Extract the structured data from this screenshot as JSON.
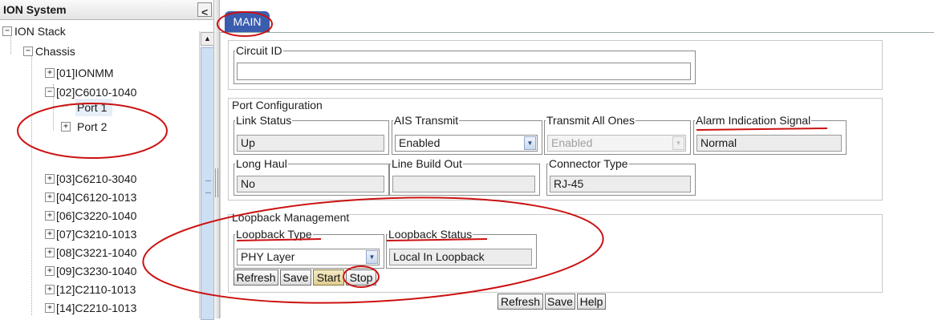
{
  "left_panel": {
    "title": "ION System",
    "collapse_glyph": "<",
    "tree": [
      {
        "label": "ION Stack",
        "level": 0,
        "expander": "−"
      },
      {
        "label": "Chassis",
        "level": 1,
        "expander": "−"
      },
      {
        "label": "[01]IONMM",
        "level": 2,
        "expander": "+"
      },
      {
        "label": "[02]C6010-1040",
        "level": 2,
        "expander": "−"
      },
      {
        "label": "Port 1",
        "level": 3,
        "expander": ""
      },
      {
        "label": "Port 2",
        "level": 3,
        "expander": "+"
      },
      {
        "label": "[03]C6210-3040",
        "level": 2,
        "expander": "+"
      },
      {
        "label": "[04]C6120-1013",
        "level": 2,
        "expander": "+"
      },
      {
        "label": "[06]C3220-1040",
        "level": 2,
        "expander": "+"
      },
      {
        "label": "[07]C3210-1013",
        "level": 2,
        "expander": "+"
      },
      {
        "label": "[08]C3221-1040",
        "level": 2,
        "expander": "+"
      },
      {
        "label": "[09]C3230-1040",
        "level": 2,
        "expander": "+"
      },
      {
        "label": "[12]C2110-1013",
        "level": 2,
        "expander": "+"
      },
      {
        "label": "[14]C2210-1013",
        "level": 2,
        "expander": "+"
      }
    ]
  },
  "tabs": [
    {
      "label": "MAIN",
      "active": true
    }
  ],
  "circuit_id": {
    "label": "Circuit ID",
    "value": ""
  },
  "port_config": {
    "title": "Port Configuration",
    "link_status": {
      "label": "Link Status",
      "value": "Up"
    },
    "ais_transmit": {
      "label": "AIS Transmit",
      "value": "Enabled"
    },
    "transmit_all_ones": {
      "label": "Transmit All Ones",
      "value": "Enabled"
    },
    "alarm_indication_signal": {
      "label": "Alarm Indication Signal",
      "value": "Normal"
    },
    "long_haul": {
      "label": "Long Haul",
      "value": "No"
    },
    "line_build_out": {
      "label": "Line Build Out",
      "value": ""
    },
    "connector_type": {
      "label": "Connector Type",
      "value": "RJ-45"
    }
  },
  "loopback": {
    "title": "Loopback Management",
    "type": {
      "label": "Loopback Type",
      "value": "PHY Layer"
    },
    "status": {
      "label": "Loopback Status",
      "value": "Local In Loopback"
    },
    "buttons": {
      "refresh": "Refresh",
      "save": "Save",
      "start": "Start",
      "stop": "Stop"
    }
  },
  "footer_buttons": {
    "refresh": "Refresh",
    "save": "Save",
    "help": "Help"
  },
  "colors": {
    "tab_active": "#3a5dae",
    "annotation": "#cc1111",
    "selected_node": "#e6eef8"
  },
  "icons": {
    "collapse": "chevron-left-icon",
    "dropdown": "chevron-down-icon",
    "scroll_up": "arrow-up-icon"
  }
}
